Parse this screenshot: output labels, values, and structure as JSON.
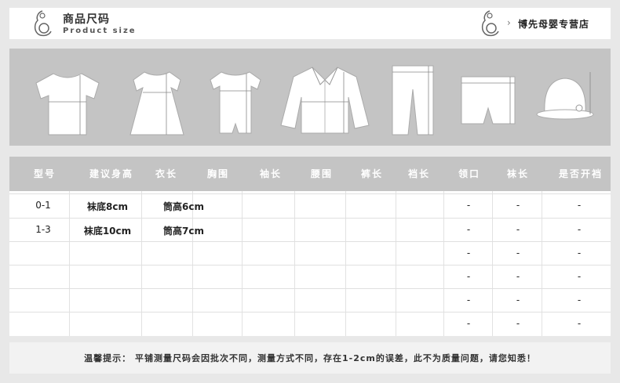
{
  "header": {
    "title_cn": "商品尺码",
    "title_en": "Product size",
    "store_chevron": "›",
    "store_name": "博先母婴专营店"
  },
  "garments": [
    "t-shirt",
    "dress",
    "romper",
    "jacket",
    "pants",
    "shorts",
    "hat"
  ],
  "table": {
    "headers": [
      "型号",
      "建议身高",
      "衣长",
      "胸围",
      "袖长",
      "腰围",
      "裤长",
      "裆长",
      "领口",
      "袜长",
      "是否开裆"
    ],
    "rows": [
      {
        "size": "0-1",
        "height": "袜底8cm",
        "length": "筒高6cm",
        "collar": "-",
        "sock_len": "-",
        "crotch": "-"
      },
      {
        "size": "1-3",
        "height": "袜底10cm",
        "length": "筒高7cm",
        "collar": "-",
        "sock_len": "-",
        "crotch": "-"
      },
      {
        "size": "",
        "height": "",
        "length": "",
        "collar": "-",
        "sock_len": "-",
        "crotch": "-"
      },
      {
        "size": "",
        "height": "",
        "length": "",
        "collar": "-",
        "sock_len": "-",
        "crotch": "-"
      },
      {
        "size": "",
        "height": "",
        "length": "",
        "collar": "-",
        "sock_len": "-",
        "crotch": "-"
      },
      {
        "size": "",
        "height": "",
        "length": "",
        "collar": "-",
        "sock_len": "-",
        "crotch": "-"
      }
    ]
  },
  "notice": "温馨提示：  平铺测量尺码会因批次不同，测量方式不同，存在1-2cm的误差，此不为质量问题，请您知悉！"
}
